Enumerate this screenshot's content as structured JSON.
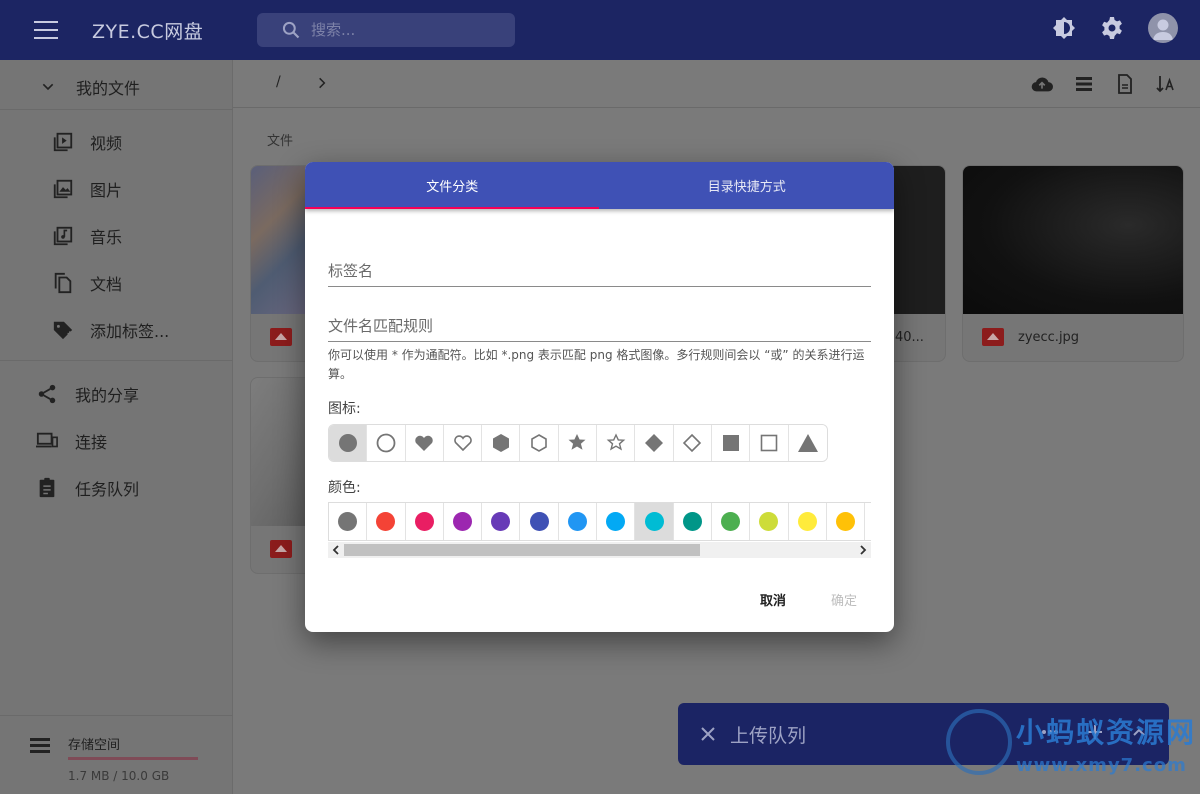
{
  "app": {
    "title": "ZYE.CC网盘",
    "search_placeholder": "搜索..."
  },
  "sidebar": {
    "my_files": "我的文件",
    "items": [
      {
        "label": "视频",
        "icon": "video-icon"
      },
      {
        "label": "图片",
        "icon": "image-icon"
      },
      {
        "label": "音乐",
        "icon": "music-icon"
      },
      {
        "label": "文档",
        "icon": "document-icon"
      },
      {
        "label": "添加标签...",
        "icon": "add-tag-icon"
      }
    ],
    "shares": "我的分享",
    "connections": "连接",
    "tasks": "任务队列",
    "storage_label": "存储空间",
    "storage_usage": "1.7 MB / 10.0 GB"
  },
  "toolbar": {
    "path": "/"
  },
  "main": {
    "section_title": "文件",
    "files": [
      {
        "name": "40..."
      },
      {
        "name": "zyecc.jpg"
      }
    ]
  },
  "dialog": {
    "tabs": [
      "文件分类",
      "目录快捷方式"
    ],
    "tag_name_placeholder": "标签名",
    "pattern_placeholder": "文件名匹配规则",
    "helper": "你可以使用 * 作为通配符。比如 *.png 表示匹配 png 格式图像。多行规则间会以 “或” 的关系进行运算。",
    "icon_label": "图标:",
    "icons": [
      "circle-filled",
      "circle-outline",
      "heart-filled",
      "heart-outline",
      "hexagon-filled",
      "hexagon-outline",
      "star-filled",
      "star-outline",
      "diamond-filled",
      "diamond-outline",
      "square-filled",
      "square-outline",
      "triangle-filled"
    ],
    "color_label": "颜色:",
    "colors": [
      "#757575",
      "#f44336",
      "#e91e63",
      "#9c27b0",
      "#673ab7",
      "#3f51b5",
      "#2196f3",
      "#03a9f4",
      "#00bcd4",
      "#009688",
      "#4caf50",
      "#cddc39",
      "#ffeb3b",
      "#ffc107",
      "#ff9800"
    ],
    "selected_color_index": 8,
    "cancel": "取消",
    "confirm": "确定"
  },
  "upload_queue": {
    "title": "上传队列"
  },
  "watermark": {
    "name": "小蚂蚁资源网",
    "url": "www.xmy7.com"
  }
}
